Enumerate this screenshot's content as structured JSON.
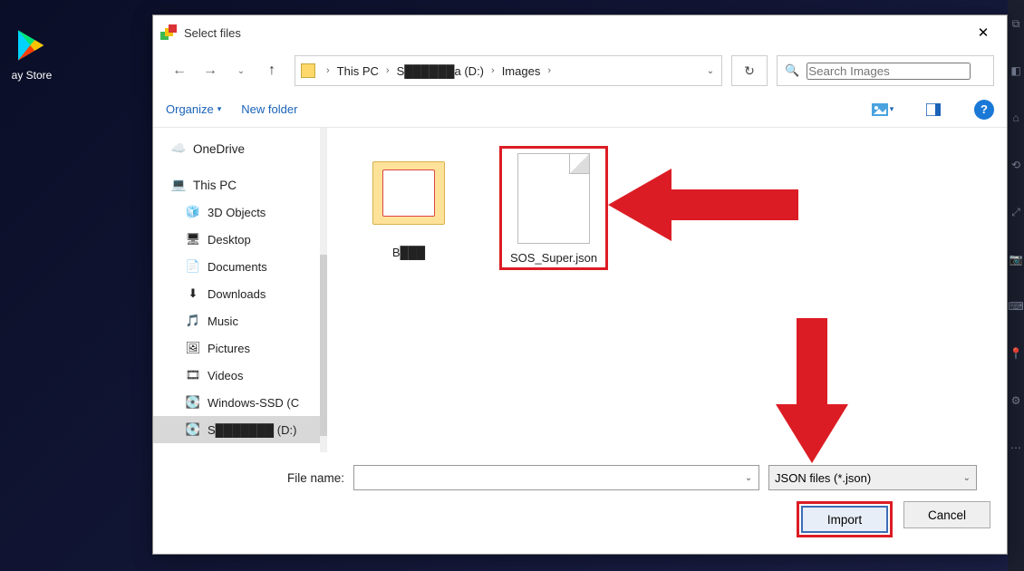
{
  "desktop": {
    "app_label": "ay Store"
  },
  "dialog": {
    "title": "Select files",
    "nav": {
      "back": "←",
      "forward": "→",
      "up": "↑",
      "refresh": "↻",
      "dropdown": "⌄"
    },
    "breadcrumb": {
      "root": "This PC",
      "drive": "S██████a (D:)",
      "folder": "Images"
    },
    "search": {
      "placeholder": "Search Images",
      "icon": "🔍"
    },
    "toolbar": {
      "organize": "Organize",
      "newfolder": "New folder",
      "caret": "▾",
      "help": "?"
    },
    "tree": {
      "onedrive": "OneDrive",
      "thispc": "This PC",
      "items": [
        {
          "icon": "🧊",
          "label": "3D Objects"
        },
        {
          "icon": "🖥",
          "label": "Desktop"
        },
        {
          "icon": "📄",
          "label": "Documents"
        },
        {
          "icon": "⬇",
          "label": "Downloads"
        },
        {
          "icon": "🎵",
          "label": "Music"
        },
        {
          "icon": "🖼",
          "label": "Pictures"
        },
        {
          "icon": "🎞",
          "label": "Videos"
        },
        {
          "icon": "💽",
          "label": "Windows-SSD (C"
        },
        {
          "icon": "💽",
          "label": "S███████ (D:)"
        }
      ]
    },
    "files": {
      "folder1": "B███",
      "json1": "SOS_Super.json"
    },
    "footer": {
      "filename_label": "File name:",
      "filename_value": "",
      "type_filter": "JSON files (*.json)",
      "import": "Import",
      "cancel": "Cancel"
    }
  }
}
